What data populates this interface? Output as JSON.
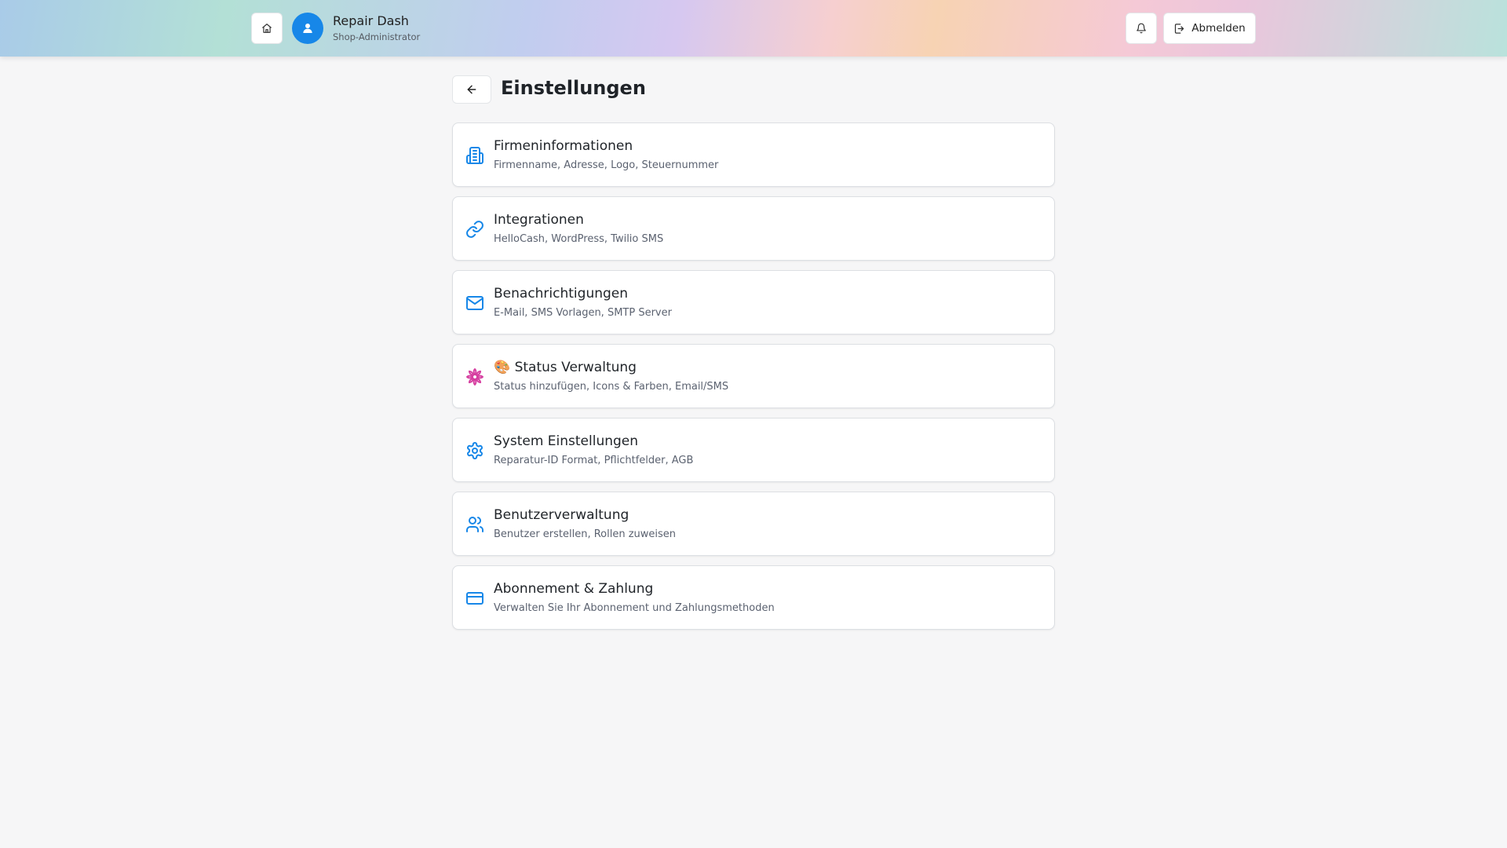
{
  "header": {
    "app_name": "Repair Dash",
    "role": "Shop-Administrator",
    "logout_label": "Abmelden",
    "home_icon": "home-icon",
    "bell_icon": "bell-icon",
    "avatar_icon": "user-icon",
    "logout_icon": "logout-icon"
  },
  "page": {
    "title": "Einstellungen",
    "back_icon": "arrow-left-icon"
  },
  "colors": {
    "accent": "#1787e8",
    "status_icon": "#d63fa0"
  },
  "settings": [
    {
      "title": "Firmeninformationen",
      "description": "Firmenname, Adresse, Logo, Steuernummer",
      "icon": "building-icon"
    },
    {
      "title": "Integrationen",
      "description": "HelloCash, WordPress, Twilio SMS",
      "icon": "link-icon"
    },
    {
      "title": "Benachrichtigungen",
      "description": "E-Mail, SMS Vorlagen, SMTP Server",
      "icon": "mail-icon"
    },
    {
      "title": "🎨 Status Verwaltung",
      "description": "Status hinzufügen, Icons & Farben, Email/SMS",
      "icon": "flower-icon"
    },
    {
      "title": "System Einstellungen",
      "description": "Reparatur-ID Format, Pflichtfelder, AGB",
      "icon": "gear-icon"
    },
    {
      "title": "Benutzerverwaltung",
      "description": "Benutzer erstellen, Rollen zuweisen",
      "icon": "users-icon"
    },
    {
      "title": "Abonnement & Zahlung",
      "description": "Verwalten Sie Ihr Abonnement und Zahlungsmethoden",
      "icon": "credit-card-icon"
    }
  ]
}
